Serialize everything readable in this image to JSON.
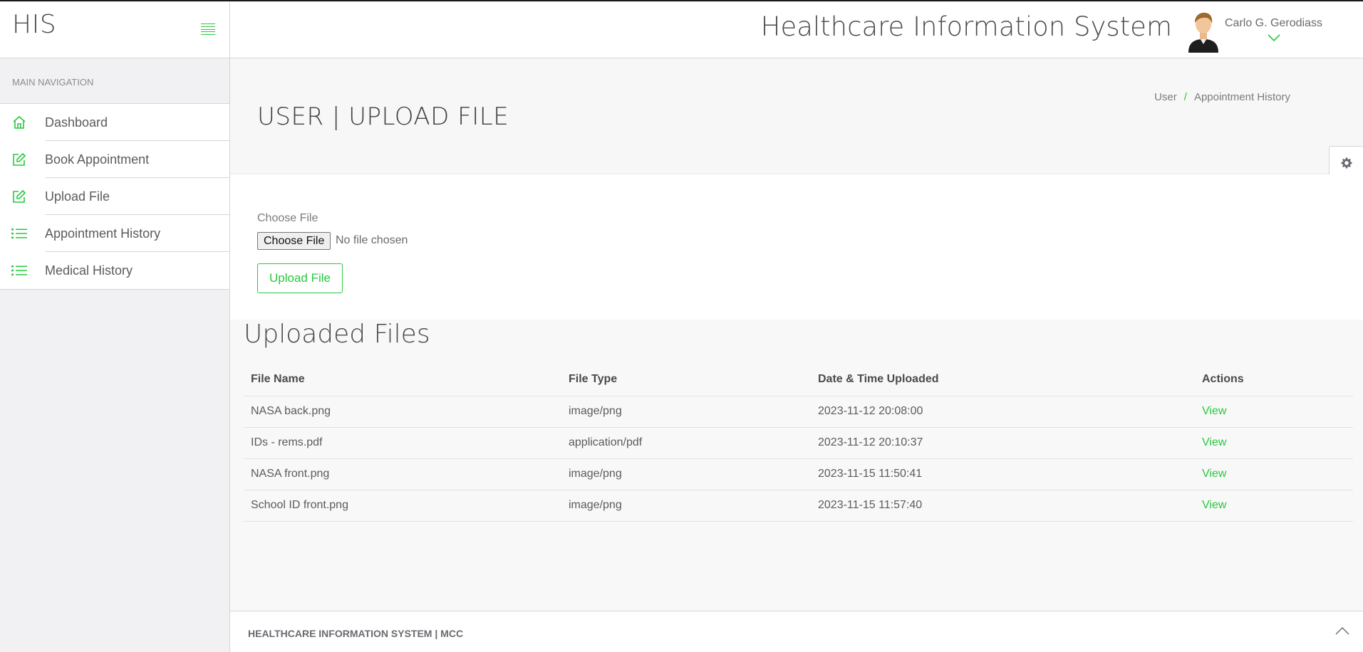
{
  "brand": "HIS",
  "sidebar": {
    "section_header": "MAIN NAVIGATION",
    "items": [
      {
        "label": "Dashboard",
        "icon": "home-icon"
      },
      {
        "label": "Book Appointment",
        "icon": "edit-icon"
      },
      {
        "label": "Upload File",
        "icon": "edit-icon"
      },
      {
        "label": "Appointment History",
        "icon": "list-icon"
      },
      {
        "label": "Medical History",
        "icon": "list-icon"
      }
    ]
  },
  "header": {
    "app_title": "Healthcare Information System",
    "user_name": "Carlo G. Gerodiass"
  },
  "page": {
    "title": "USER | UPLOAD FILE",
    "breadcrumb": [
      "User",
      "Appointment History"
    ]
  },
  "upload": {
    "label": "Choose File",
    "file_button": "Choose File",
    "file_status": "No file chosen",
    "submit_label": "Upload File"
  },
  "files": {
    "title": "Uploaded Files",
    "columns": [
      "File Name",
      "File Type",
      "Date & Time Uploaded",
      "Actions"
    ],
    "rows": [
      {
        "name": "NASA back.png",
        "type": "image/png",
        "uploaded": "2023-11-12 20:08:00",
        "action": "View"
      },
      {
        "name": "IDs - rems.pdf",
        "type": "application/pdf",
        "uploaded": "2023-11-12 20:10:37",
        "action": "View"
      },
      {
        "name": "NASA front.png",
        "type": "image/png",
        "uploaded": "2023-11-15 11:50:41",
        "action": "View"
      },
      {
        "name": "School ID front.png",
        "type": "image/png",
        "uploaded": "2023-11-15 11:57:40",
        "action": "View"
      }
    ]
  },
  "footer": {
    "text": "HEALTHCARE INFORMATION SYSTEM | MCC"
  },
  "colors": {
    "accent": "#27c93f",
    "sidebar_bg": "#f1f1f3",
    "page_bg": "#f8f8f8"
  }
}
